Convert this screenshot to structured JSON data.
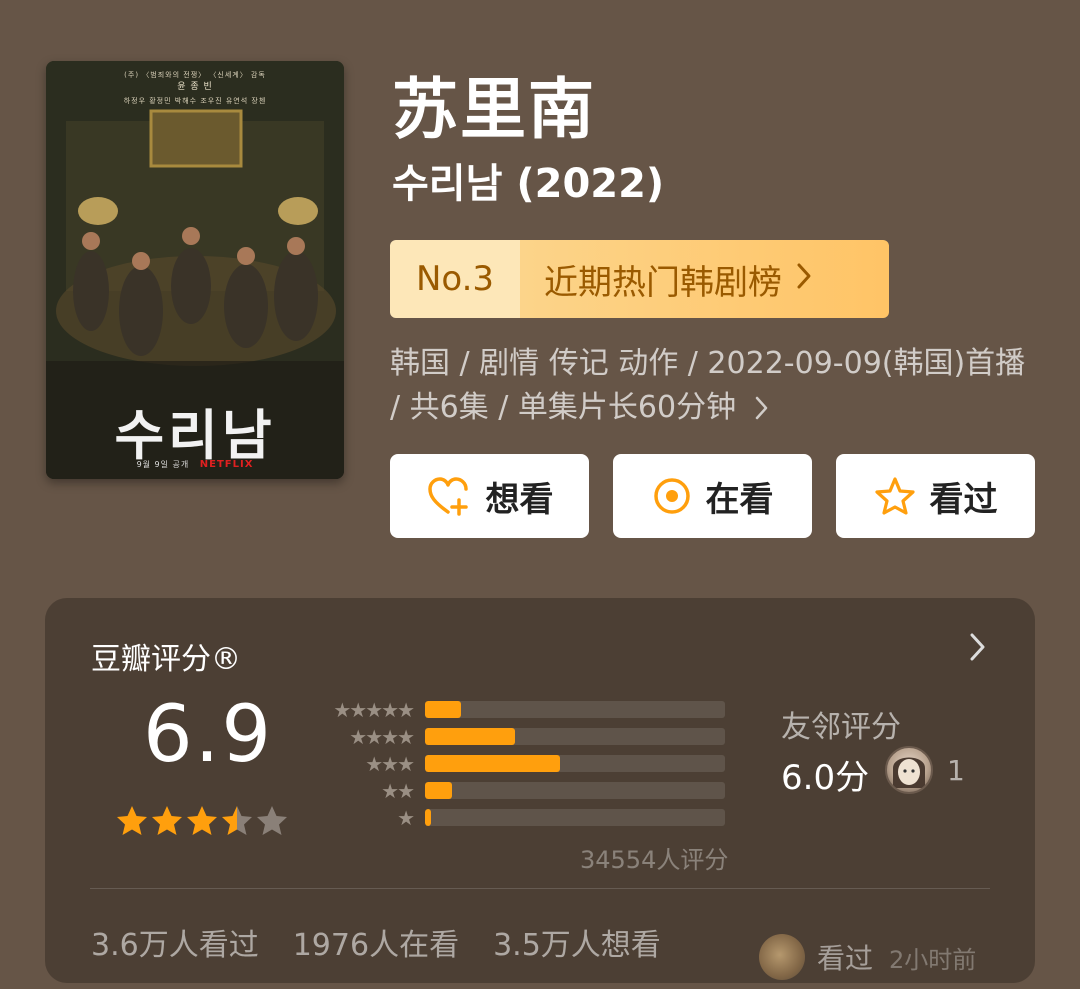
{
  "poster": {
    "credits_line1": "(주)  〈범죄와의 전쟁〉 〈신세계〉 감독",
    "credits_line2": "윤 종 빈",
    "credits_line3": "하정우  황정민  박해수  조우진  유연석  장첸",
    "title_art": "수리남",
    "release_note": "9월 9일 공개",
    "logo": "NETFLIX"
  },
  "title": {
    "cn": "苏里南",
    "original": "수리남 (2022)"
  },
  "rank": {
    "number": "No.3",
    "list_name": "近期热门韩剧榜",
    "chevron": "chevron-right-icon"
  },
  "meta": {
    "text": "韩国 / 剧情 传记 动作 / 2022-09-09(韩国)首播 / 共6集 / 单集片长60分钟"
  },
  "actions": {
    "want_label": "想看",
    "watching_label": "在看",
    "watched_label": "看过",
    "accent": "#ff9f0d"
  },
  "rating": {
    "title": "豆瓣评分®",
    "score": "6.9",
    "stars_value": 3.5,
    "stars_max": 5,
    "distribution": [
      {
        "stars": "★★★★★",
        "fraction": 0.12
      },
      {
        "stars": "★★★★",
        "fraction": 0.3
      },
      {
        "stars": "★★★",
        "fraction": 0.45
      },
      {
        "stars": "★★",
        "fraction": 0.09
      },
      {
        "stars": "★",
        "fraction": 0.02
      }
    ],
    "count": "34554人评分",
    "friends_label": "友邻评分",
    "friends_score": "6.0分",
    "friends_count": "1",
    "watched": "3.6万人看过",
    "watching": "1976人在看",
    "want": "3.5万人想看",
    "activity_action": "看过",
    "activity_time": "2小时前"
  }
}
